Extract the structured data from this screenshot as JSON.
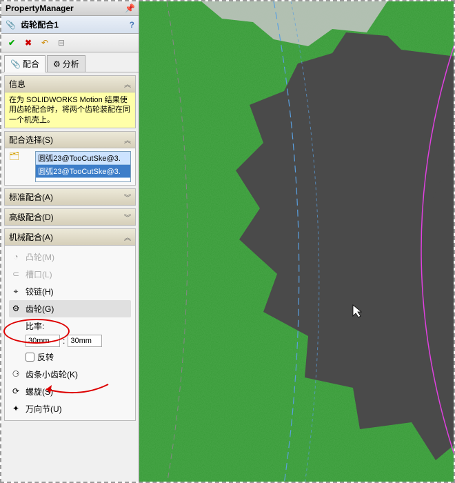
{
  "header": {
    "title": "PropertyManager"
  },
  "feature_title": "齿轮配合1",
  "tabs": {
    "mate": "配合",
    "analysis": "分析"
  },
  "sections": {
    "info": {
      "title": "信息",
      "body": "在为 SOLIDWORKS Motion 结果使用齿轮配合时，将两个齿轮装配在同一个机壳上。"
    },
    "mate_selections": {
      "title": "配合选择(S)",
      "items": [
        "圆弧23@TooCutSke@3.",
        "圆弧23@TooCutSke@3."
      ]
    },
    "standard": {
      "title": "标准配合(A)"
    },
    "advanced": {
      "title": "高级配合(D)"
    },
    "mechanical": {
      "title": "机械配合(A)",
      "items": {
        "cam": "凸轮(M)",
        "slot": "槽口(L)",
        "hinge": "铰链(H)",
        "gear": "齿轮(G)",
        "ratio_label": "比率:",
        "ratio_a": "30mm",
        "ratio_b": "30mm",
        "reverse": "反转",
        "rack": "齿条小齿轮(K)",
        "screw": "螺旋(S)",
        "universal": "万向节(U)"
      }
    }
  },
  "colors": {
    "info_bg": "#FFFFA8",
    "selection_bg": "#cce3ff",
    "selection_sel": "#3d7ec9"
  }
}
